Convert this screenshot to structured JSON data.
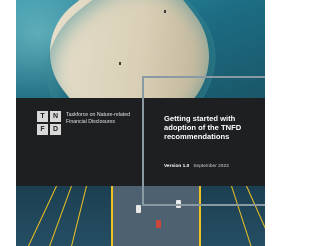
{
  "cover": {
    "logo_letters": [
      "T",
      "N",
      "F",
      "D"
    ],
    "organization": "Taskforce on Nature-related Financial Disclosures",
    "title": "Getting started with adoption of the TNFD recommendations",
    "version": "Version 1.0",
    "date": "September 2023"
  },
  "colors": {
    "band": "#1e1f21",
    "sea": "#1c6c82",
    "frame": "#8a9aa3",
    "cable": "#f0c21f"
  }
}
